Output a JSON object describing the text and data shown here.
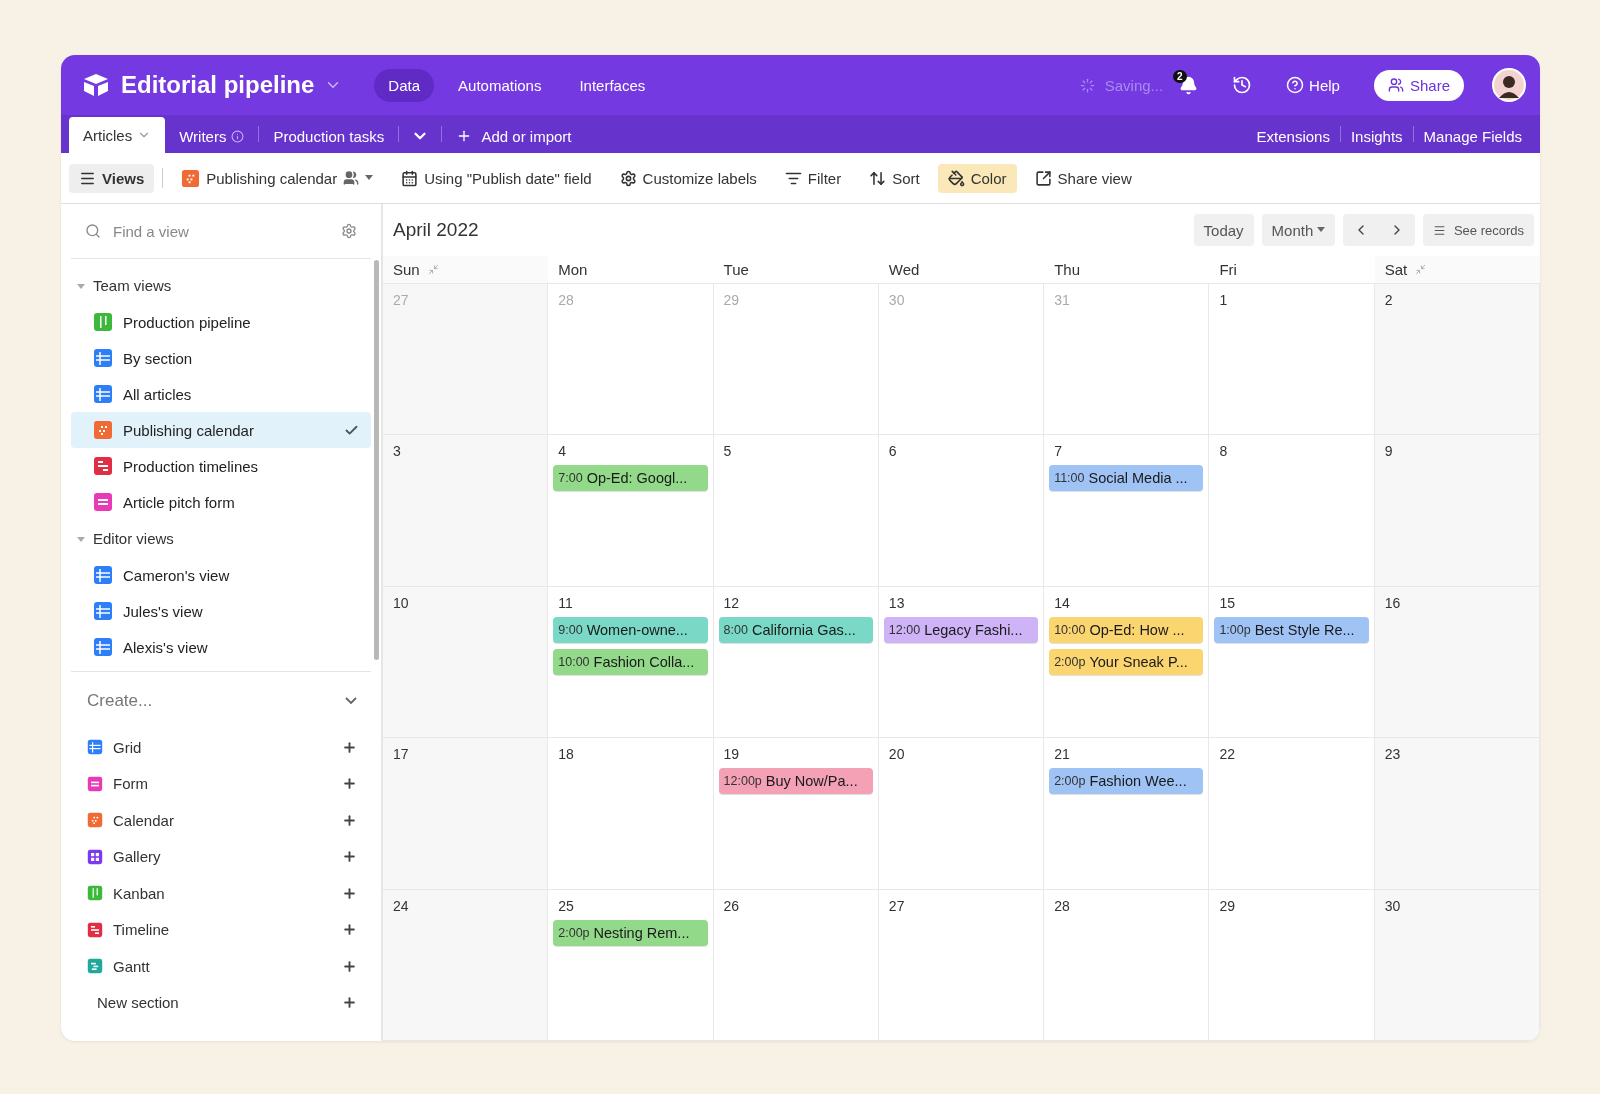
{
  "app": {
    "title": "Editorial pipeline",
    "nav": [
      {
        "label": "Data",
        "selected": true
      },
      {
        "label": "Automations",
        "selected": false
      },
      {
        "label": "Interfaces",
        "selected": false
      }
    ],
    "status": "Saving...",
    "notifications": "2",
    "help": "Help",
    "share": "Share"
  },
  "tables": {
    "items": [
      {
        "label": "Articles",
        "selected": true,
        "kind": "caret"
      },
      {
        "label": "Writers",
        "selected": false,
        "kind": "info"
      },
      {
        "label": "Production tasks",
        "selected": false,
        "kind": "plain"
      }
    ],
    "add": "Add or import",
    "right": [
      "Extensions",
      "Insights",
      "Manage Fields"
    ]
  },
  "toolbar": {
    "items": [
      {
        "label": "Views",
        "kind": "views",
        "active": true
      },
      {
        "label": "Publishing calendar",
        "kind": "view",
        "active": false
      },
      {
        "label": "Using \"Publish date\" field",
        "kind": "date",
        "active": false
      },
      {
        "label": "Customize labels",
        "kind": "gear",
        "active": false
      },
      {
        "label": "Filter",
        "kind": "filter",
        "active": false
      },
      {
        "label": "Sort",
        "kind": "sort",
        "active": false
      },
      {
        "label": "Color",
        "kind": "color",
        "active": true
      },
      {
        "label": "Share view",
        "kind": "share",
        "active": false
      }
    ]
  },
  "sidebar": {
    "search": {
      "placeholder": "Find a view"
    },
    "sections": [
      {
        "label": "Team views",
        "expanded": true,
        "children": [
          {
            "label": "Production pipeline",
            "kind": "kanban",
            "selected": false
          },
          {
            "label": "By section",
            "kind": "grid",
            "selected": false
          },
          {
            "label": "All articles",
            "kind": "grid",
            "selected": false
          },
          {
            "label": "Publishing calendar",
            "kind": "calendar",
            "selected": true
          },
          {
            "label": "Production timelines",
            "kind": "timeline",
            "selected": false
          },
          {
            "label": "Article pitch form",
            "kind": "form",
            "selected": false
          }
        ]
      },
      {
        "label": "Editor views",
        "expanded": true,
        "children": [
          {
            "label": "Cameron's view",
            "kind": "grid",
            "selected": false
          },
          {
            "label": "Jules's view",
            "kind": "grid",
            "selected": false
          },
          {
            "label": "Alexis's view",
            "kind": "grid",
            "selected": false
          }
        ]
      }
    ],
    "create": {
      "label": "Create...",
      "items": [
        {
          "label": "Grid",
          "kind": "grid"
        },
        {
          "label": "Form",
          "kind": "form"
        },
        {
          "label": "Calendar",
          "kind": "calendar"
        },
        {
          "label": "Gallery",
          "kind": "gallery"
        },
        {
          "label": "Kanban",
          "kind": "kanban"
        },
        {
          "label": "Timeline",
          "kind": "timeline"
        },
        {
          "label": "Gantt",
          "kind": "gantt"
        },
        {
          "label": "New section",
          "kind": "section"
        }
      ]
    }
  },
  "calendar": {
    "title": "April 2022",
    "controls": {
      "today": "Today",
      "mode": "Month",
      "records": "See records"
    },
    "days": [
      {
        "label": "Sun",
        "collapsible": true
      },
      {
        "label": "Mon",
        "collapsible": false
      },
      {
        "label": "Tue",
        "collapsible": false
      },
      {
        "label": "Wed",
        "collapsible": false
      },
      {
        "label": "Thu",
        "collapsible": false
      },
      {
        "label": "Fri",
        "collapsible": false
      },
      {
        "label": "Sat",
        "collapsible": true
      }
    ],
    "weeks": [
      [
        {
          "date": "27",
          "muted": true
        },
        {
          "date": "28",
          "muted": true
        },
        {
          "date": "29",
          "muted": true
        },
        {
          "date": "30",
          "muted": true
        },
        {
          "date": "31",
          "muted": true
        },
        {
          "date": "1",
          "muted": false
        },
        {
          "date": "2",
          "muted": false
        }
      ],
      [
        {
          "date": "3",
          "muted": false
        },
        {
          "date": "4",
          "muted": false,
          "events": [
            {
              "time": "7:00",
              "title": "Op-Ed: Googl...",
              "color": "#93d98a"
            }
          ]
        },
        {
          "date": "5",
          "muted": false
        },
        {
          "date": "6",
          "muted": false
        },
        {
          "date": "7",
          "muted": false,
          "events": [
            {
              "time": "11:00",
              "title": "Social Media ...",
              "color": "#a0c3f6"
            }
          ]
        },
        {
          "date": "8",
          "muted": false
        },
        {
          "date": "9",
          "muted": false
        }
      ],
      [
        {
          "date": "10",
          "muted": false
        },
        {
          "date": "11",
          "muted": false,
          "events": [
            {
              "time": "9:00",
              "title": "Women-owne...",
              "color": "#7ad9c6"
            },
            {
              "time": "10:00",
              "title": "Fashion Colla...",
              "color": "#93d98a"
            }
          ]
        },
        {
          "date": "12",
          "muted": false,
          "events": [
            {
              "time": "8:00",
              "title": "California Gas...",
              "color": "#7ad9c6"
            }
          ]
        },
        {
          "date": "13",
          "muted": false,
          "events": [
            {
              "time": "12:00",
              "title": "Legacy Fashi...",
              "color": "#ceb3f6"
            }
          ]
        },
        {
          "date": "14",
          "muted": false,
          "events": [
            {
              "time": "10:00",
              "title": "Op-Ed: How ...",
              "color": "#fbd56f"
            },
            {
              "time": "2:00p",
              "title": "Your Sneak P...",
              "color": "#fbd56f"
            }
          ]
        },
        {
          "date": "15",
          "muted": false,
          "events": [
            {
              "time": "1:00p",
              "title": "Best Style Re...",
              "color": "#a0c3f6"
            }
          ]
        },
        {
          "date": "16",
          "muted": false
        }
      ],
      [
        {
          "date": "17",
          "muted": false
        },
        {
          "date": "18",
          "muted": false
        },
        {
          "date": "19",
          "muted": false,
          "events": [
            {
              "time": "12:00p",
              "title": "Buy Now/Pa...",
              "color": "#f4a1b6"
            }
          ]
        },
        {
          "date": "20",
          "muted": false
        },
        {
          "date": "21",
          "muted": false,
          "events": [
            {
              "time": "2:00p",
              "title": "Fashion Wee...",
              "color": "#a0c3f6"
            }
          ]
        },
        {
          "date": "22",
          "muted": false
        },
        {
          "date": "23",
          "muted": false
        }
      ],
      [
        {
          "date": "24",
          "muted": false
        },
        {
          "date": "25",
          "muted": false,
          "events": [
            {
              "time": "2:00p",
              "title": "Nesting Rem...",
              "color": "#93d98a"
            }
          ]
        },
        {
          "date": "26",
          "muted": false
        },
        {
          "date": "27",
          "muted": false
        },
        {
          "date": "28",
          "muted": false
        },
        {
          "date": "29",
          "muted": false
        },
        {
          "date": "30",
          "muted": false
        }
      ]
    ]
  }
}
